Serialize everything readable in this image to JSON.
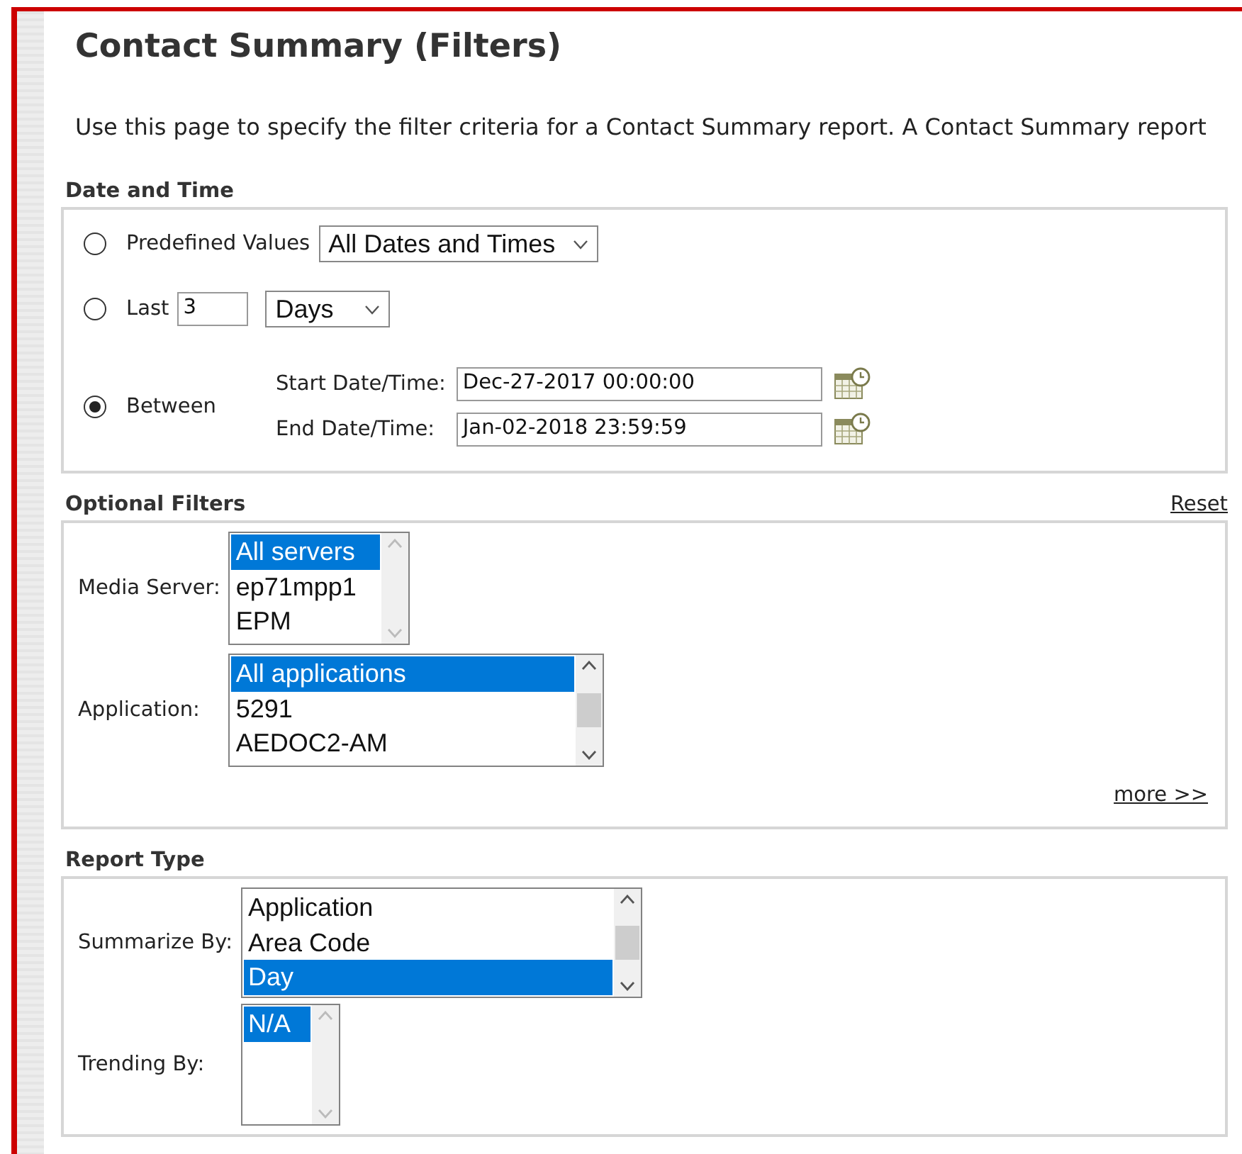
{
  "title": "Contact Summary (Filters)",
  "intro": "Use this page to specify the filter criteria for a Contact Summary report. A Contact Summary report",
  "date_time": {
    "heading": "Date and Time",
    "options": [
      {
        "kind": "predefined",
        "label": "Predefined Values",
        "selected": false,
        "value": "All Dates and Times"
      },
      {
        "kind": "last",
        "label": "Last",
        "selected": false,
        "count": "3",
        "unit": "Days"
      },
      {
        "kind": "between",
        "label": "Between",
        "selected": true,
        "fields": [
          {
            "label": "Start Date/Time:",
            "value": "Dec-27-2017 00:00:00"
          },
          {
            "label": "End Date/Time:",
            "value": "Jan-02-2018 23:59:59"
          }
        ]
      }
    ]
  },
  "optional_filters": {
    "heading": "Optional Filters",
    "reset": "Reset",
    "more": "more >>",
    "lists": [
      {
        "label": "Media Server:",
        "scrollable": false,
        "items": [
          {
            "text": "All servers",
            "selected": true
          },
          {
            "text": "ep71mpp1",
            "selected": false
          },
          {
            "text": "EPM",
            "selected": false
          }
        ]
      },
      {
        "label": "Application:",
        "scrollable": true,
        "items": [
          {
            "text": "All applications",
            "selected": true
          },
          {
            "text": "5291",
            "selected": false
          },
          {
            "text": "AEDOC2-AM",
            "selected": false
          }
        ]
      }
    ]
  },
  "report_type": {
    "heading": "Report Type",
    "lists": [
      {
        "label": "Summarize By:",
        "scrollable": true,
        "items": [
          {
            "text": "Application",
            "selected": false
          },
          {
            "text": "Area Code",
            "selected": false
          },
          {
            "text": "Day",
            "selected": true
          }
        ]
      },
      {
        "label": "Trending By:",
        "scrollable": false,
        "items": [
          {
            "text": "N/A",
            "selected": true
          }
        ]
      }
    ]
  }
}
